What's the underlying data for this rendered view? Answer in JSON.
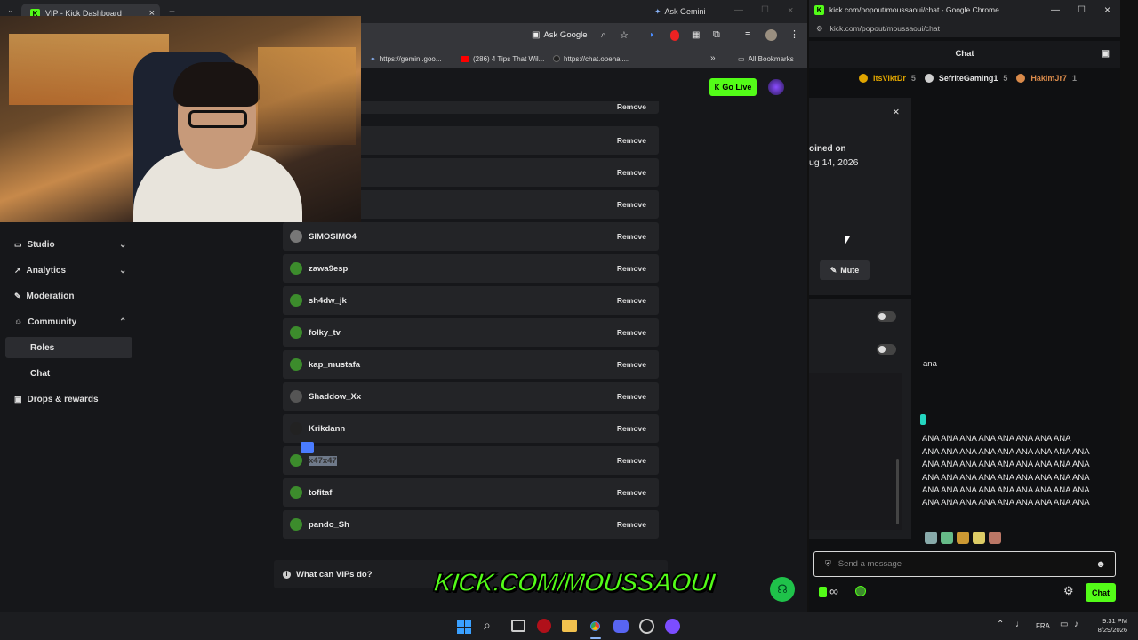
{
  "browser_left": {
    "tab_title": "VIP - Kick Dashboard",
    "new_tab_symbol": "+",
    "ask_gemini": "Ask Gemini",
    "ask_google": "Ask Google",
    "bookmarks": [
      "https://gemini.goo...",
      "(286) 4 Tips That Wil...",
      "https://chat.openai...."
    ],
    "all_bookmarks": "All Bookmarks"
  },
  "dashboard": {
    "go_live": "Go Live",
    "sidebar": [
      {
        "label": "Studio",
        "chevron": "⌄"
      },
      {
        "label": "Analytics",
        "chevron": "⌄"
      },
      {
        "label": "Moderation",
        "chevron": ""
      },
      {
        "label": "Community",
        "chevron": "⌃"
      },
      {
        "label": "Roles",
        "chevron": ""
      },
      {
        "label": "Chat",
        "chevron": ""
      },
      {
        "label": "Drops & rewards",
        "chevron": ""
      }
    ],
    "remove_label": "Remove",
    "vips": [
      "",
      "",
      "",
      "",
      "SIMOSIMO4",
      "zawa9esp",
      "sh4dw_jk",
      "folky_tv",
      "kap_mustafa",
      "Shaddow_Xx",
      "Krikdann",
      "x47x47",
      "tofitaf",
      "pando_Sh"
    ],
    "faq": "What can VIPs do?",
    "watermark": "KICK.COM/MOUSSAOUI"
  },
  "browser_right": {
    "window_title": "kick.com/popout/moussaoui/chat - Google Chrome",
    "url": "kick.com/popout/moussaoui/chat",
    "chat_title": "Chat",
    "top_gifters": [
      {
        "name": "ItsViktDr",
        "count": "5",
        "color": "#e0a500"
      },
      {
        "name": "SefriteGaming1",
        "count": "5",
        "color": "#cfcfcf"
      },
      {
        "name": "HakimJr7",
        "count": "1",
        "color": "#d98a4a"
      }
    ],
    "close_symbol": "×",
    "joined_on": "oined on",
    "joined_date": "ug 14, 2026",
    "mute_label": "Mute",
    "partial_text": "ana",
    "spam_lines": [
      "ANA ANA ANA ANA ANA ANA ANA ANA",
      "ANA ANA ANA ANA ANA ANA ANA ANA ANA",
      "ANA ANA ANA ANA ANA ANA ANA ANA ANA",
      "ANA ANA ANA ANA ANA ANA ANA ANA ANA",
      "ANA ANA ANA ANA ANA ANA ANA ANA ANA",
      "ANA ANA ANA ANA ANA ANA ANA ANA ANA"
    ],
    "input_placeholder": "Send a message",
    "infinity": "∞",
    "chat_button": "Chat"
  },
  "taskbar": {
    "language": "FRA",
    "time": "9:31 PM",
    "date": "8/29/2026"
  },
  "colors": {
    "kick_green": "#53fc18"
  }
}
